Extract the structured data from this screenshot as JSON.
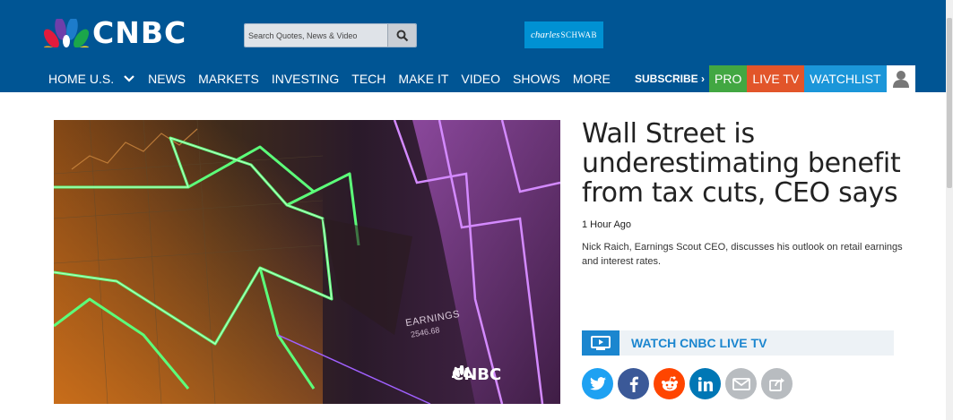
{
  "header": {
    "logo_text": "CNBC",
    "search": {
      "placeholder": "Search Quotes, News & Video",
      "button_icon": "search-icon"
    },
    "sponsor": {
      "brand": "charles",
      "brand2": "SCHWAB"
    }
  },
  "nav": {
    "items": [
      {
        "label": "HOME U.S."
      },
      {
        "label": "NEWS"
      },
      {
        "label": "MARKETS"
      },
      {
        "label": "INVESTING"
      },
      {
        "label": "TECH"
      },
      {
        "label": "MAKE IT"
      },
      {
        "label": "VIDEO"
      },
      {
        "label": "SHOWS"
      },
      {
        "label": "MORE"
      }
    ],
    "subscribe": "SUBSCRIBE ›",
    "pro": "PRO",
    "live_tv": "LIVE TV",
    "watchlist": "WATCHLIST",
    "user_icon": "user-icon"
  },
  "video": {
    "earnings_label": "EARNINGS",
    "earnings_value": "2546.68",
    "watermark": "CNBC"
  },
  "article": {
    "headline": "Wall Street is underestimating benefit from tax cuts, CEO says",
    "time": "1 Hour Ago",
    "description": "Nick Raich, Earnings Scout CEO, discusses his outlook on retail earnings and interest rates."
  },
  "watch_live": {
    "label": "WATCH CNBC LIVE TV",
    "icon": "tv-play-icon"
  },
  "share": {
    "icons": [
      "twitter-icon",
      "facebook-icon",
      "reddit-icon",
      "linkedin-icon",
      "email-icon",
      "share-icon"
    ]
  },
  "colors": {
    "header_bg": "#005594",
    "pro": "#42a742",
    "live_tv": "#e2552a",
    "watchlist": "#1b96d9",
    "accent_blue": "#1b86cf"
  }
}
